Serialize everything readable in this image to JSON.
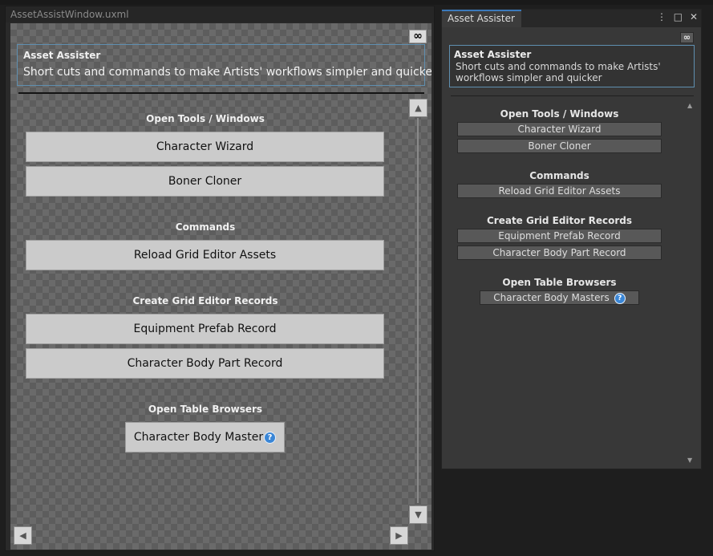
{
  "uxml_preview": {
    "title": "AssetAssistWindow.uxml",
    "link_icon": "∞",
    "header": {
      "title": "Asset Assister",
      "description": "Short cuts and commands to make Artists' workflows simpler and quicker"
    },
    "sections": {
      "open_tools": "Open Tools / Windows",
      "commands": "Commands",
      "create_records": "Create Grid Editor Records",
      "open_browsers": "Open Table Browsers"
    },
    "buttons": {
      "character_wizard": "Character Wizard",
      "boner_cloner": "Boner Cloner",
      "reload_grid": "Reload Grid Editor Assets",
      "equipment_prefab": "Equipment Prefab Record",
      "character_body_part": "Character Body Part Record",
      "character_body_masters": "Character Body Master"
    },
    "help_icon": "?",
    "scroll_up": "▲",
    "scroll_down": "▼",
    "scroll_left": "◀",
    "scroll_right": "▶"
  },
  "editor_window": {
    "tab_label": "Asset Assister",
    "menu_icon": "⋮",
    "maximize_icon": "□",
    "close_icon": "✕",
    "link_icon": "∞",
    "header": {
      "title": "Asset Assister",
      "description": "Short cuts and commands to make Artists' workflows simpler and quicker"
    },
    "sections": {
      "open_tools": "Open Tools / Windows",
      "commands": "Commands",
      "create_records": "Create Grid Editor Records",
      "open_browsers": "Open Table Browsers"
    },
    "buttons": {
      "character_wizard": "Character Wizard",
      "boner_cloner": "Boner Cloner",
      "reload_grid": "Reload Grid Editor Assets",
      "equipment_prefab": "Equipment Prefab Record",
      "character_body_part": "Character Body Part Record",
      "character_body_masters": "Character Body Masters"
    },
    "help_icon": "?",
    "scroll_up": "▲",
    "scroll_down": "▼"
  }
}
